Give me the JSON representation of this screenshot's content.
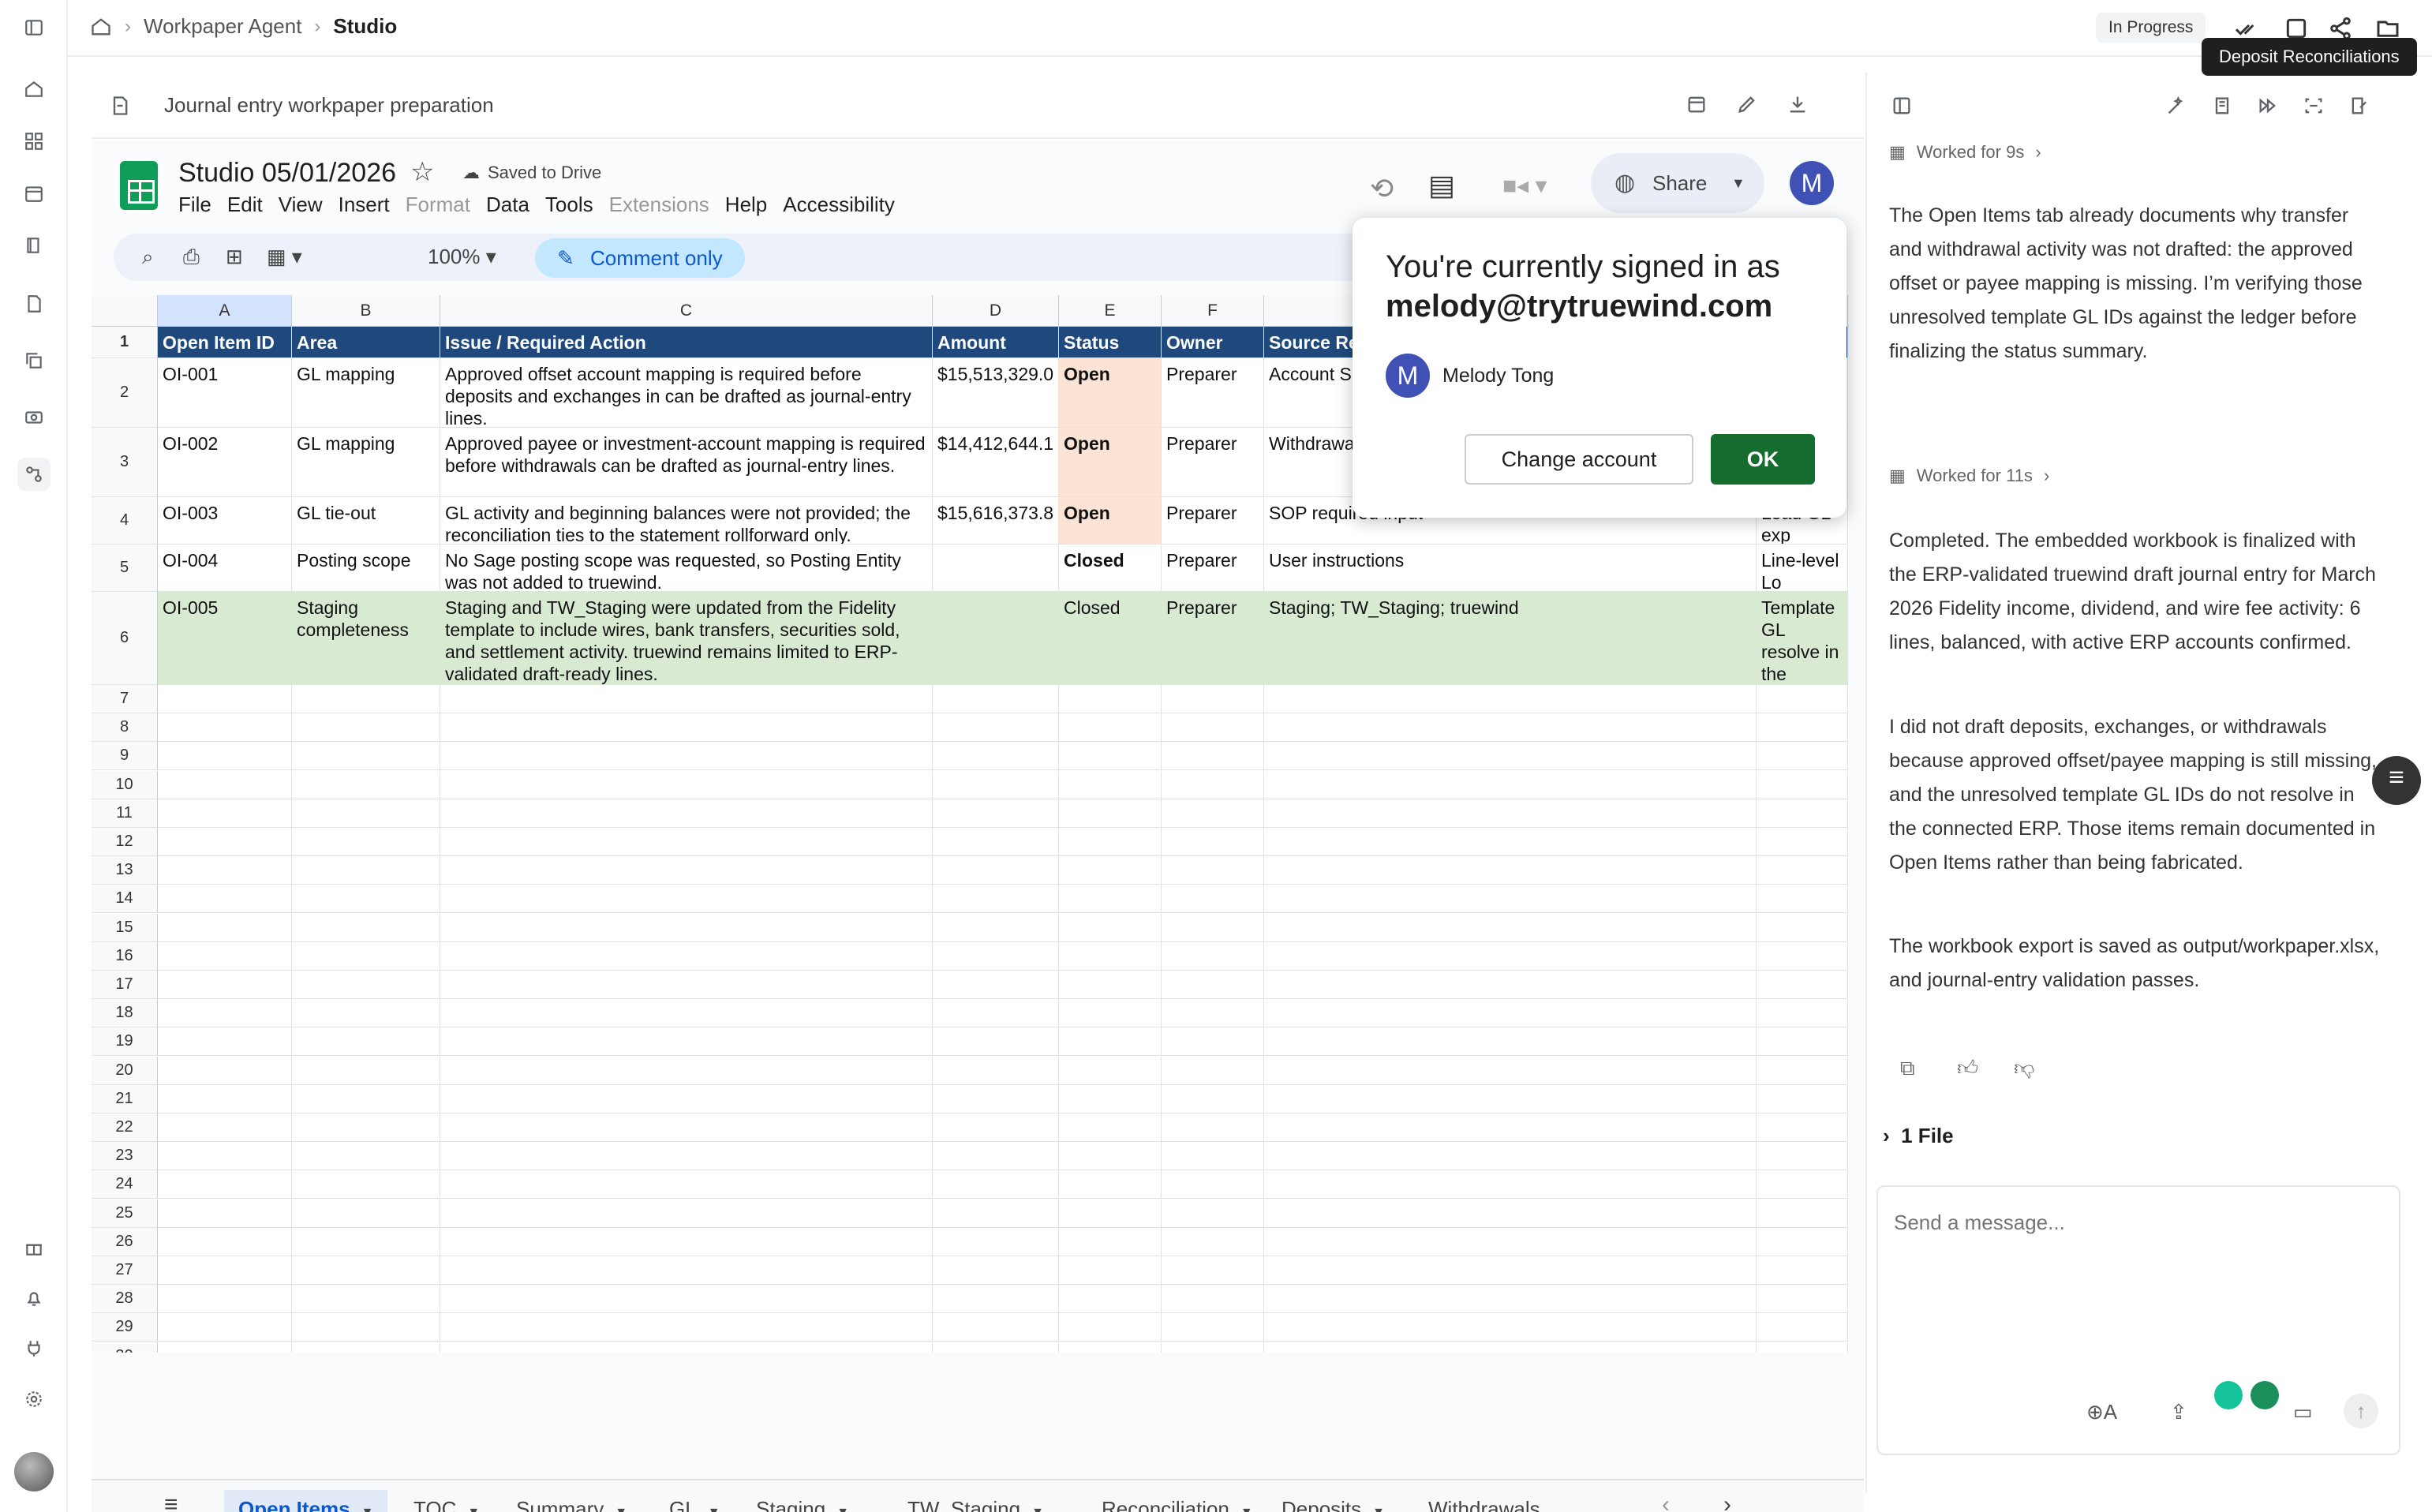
{
  "breadcrumb": [
    "Workpaper Agent",
    "Studio"
  ],
  "status_badge": "In Progress",
  "tooltip": "Deposit Reconciliations",
  "doc": {
    "title": "Journal entry workpaper preparation"
  },
  "sheets": {
    "name": "Studio 05/01/2026",
    "saved": "Saved to Drive",
    "menu": [
      "File",
      "Edit",
      "View",
      "Insert",
      "Format",
      "Data",
      "Tools",
      "Extensions",
      "Help",
      "Accessibility"
    ],
    "zoom": "100%",
    "comment_only": "Comment only",
    "share": "Share",
    "avatar_initial": "M",
    "columns": [
      "A",
      "B",
      "C",
      "D",
      "E",
      "F"
    ],
    "header_row": [
      "Open Item ID",
      "Area",
      "Issue / Required Action",
      "Amount",
      "Status",
      "Owner",
      "Source Ref"
    ],
    "rows": [
      [
        "OI-001",
        "GL mapping",
        "Approved offset account mapping is required before deposits and exchanges in can be drafted as journal-entry lines.",
        "$15,513,329.0",
        "Open",
        "Preparer",
        "Account Su",
        ""
      ],
      [
        "OI-002",
        "GL mapping",
        "Approved payee or investment-account mapping is required before withdrawals can be drafted as journal-entry lines.",
        "$14,412,644.1",
        "Open",
        "Preparer",
        "Withdrawals",
        ""
      ],
      [
        "OI-003",
        "GL tie-out",
        "GL activity and beginning balances were not provided; the reconciliation ties to the statement rollforward only.",
        "$15,616,373.8",
        "Open",
        "Preparer",
        "SOP required input",
        "Load GL exp"
      ],
      [
        "OI-004",
        "Posting scope",
        "No Sage posting scope was requested, so Posting Entity was not added to truewind.",
        "",
        "Closed",
        "Preparer",
        "User instructions",
        "Line-level Lo approved dim"
      ],
      [
        "OI-005",
        "Staging completeness",
        "Staging and TW_Staging were updated from the Fidelity template to include wires, bank transfers, securities sold, and settlement activity. truewind remains limited to ERP-validated draft-ready lines.",
        "",
        "Closed",
        "Preparer",
        "Staging; TW_Staging; truewind",
        "Template GL resolve in the mappings we"
      ]
    ],
    "empty_rows": [
      "7",
      "8",
      "9",
      "10",
      "11",
      "12",
      "13",
      "14",
      "15",
      "16",
      "17",
      "18",
      "19",
      "20",
      "21",
      "22",
      "23",
      "24",
      "25",
      "26",
      "27",
      "28",
      "29",
      "30"
    ],
    "tabs": [
      "Open Items",
      "TOC",
      "Summary",
      "GL",
      "Staging",
      "TW_Staging",
      "Reconciliation",
      "Deposits",
      "Withdrawals"
    ]
  },
  "popup": {
    "title": "You're currently signed in as",
    "email": "melody@trytruewind.com",
    "avatar_initial": "M",
    "name": "Melody Tong",
    "change": "Change account",
    "ok": "OK"
  },
  "chat": {
    "worked1": "Worked for 9s",
    "p1": "The Open Items tab already documents why transfer and withdrawal activity was not drafted: the approved offset or payee mapping is missing. I’m verifying those unresolved template GL IDs against the ledger before finalizing the status summary.",
    "worked2": "Worked for 11s",
    "p2": "Completed. The embedded workbook is finalized with the ERP-validated truewind draft journal entry for March 2026 Fidelity income, dividend, and wire fee activity: 6 lines, balanced, with active ERP accounts confirmed.",
    "p3": "I did not draft deposits, exchanges, or withdrawals because approved offset/payee mapping is still missing, and the unresolved template GL IDs do not resolve in the connected ERP. Those items remain documented in Open Items rather than being fabricated.",
    "p4": "The workbook export is saved as output/workpaper.xlsx, and journal-entry validation passes.",
    "files": "1 File",
    "placeholder": "Send a message..."
  }
}
